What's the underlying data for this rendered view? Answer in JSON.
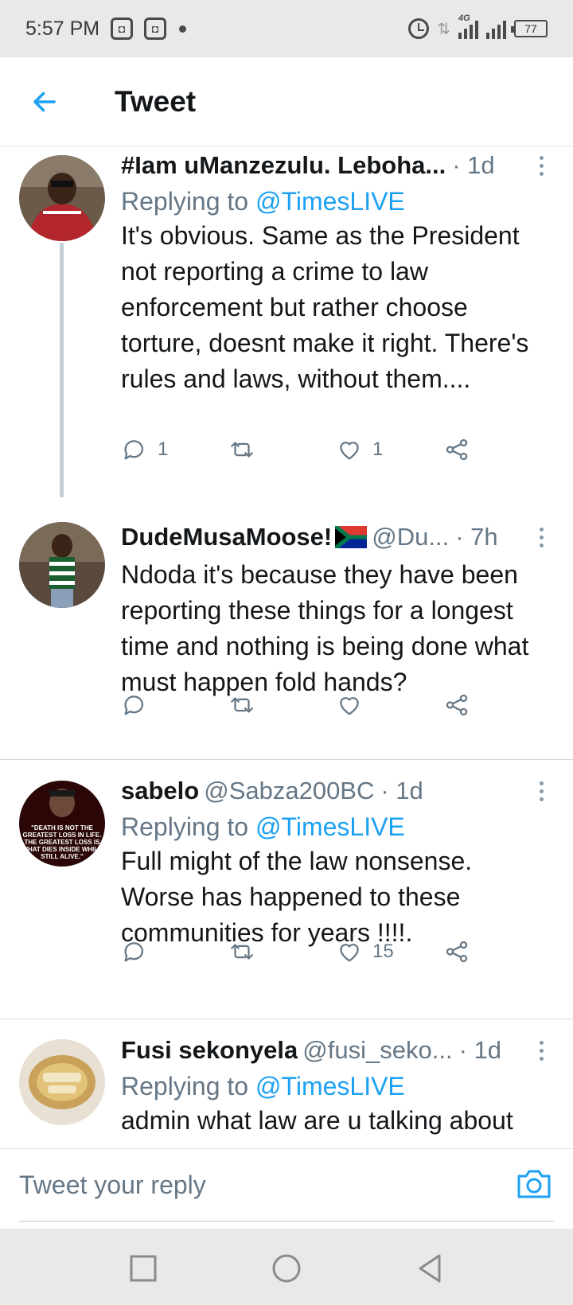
{
  "status_bar": {
    "time": "5:57 PM",
    "notification_icons": [
      "app-notification-icon",
      "app-notification-icon"
    ],
    "network": "4G",
    "battery": "77"
  },
  "header": {
    "title": "Tweet",
    "back_icon": "arrow-left-icon"
  },
  "tweets": [
    {
      "name": "#Iam uManzezulu. Leboha...",
      "handle": "",
      "time": "· 1d",
      "replying_prefix": "Replying to",
      "replying_to": "@TimesLIVE",
      "text": "It's obvious. Same as the President not reporting a crime to law enforcement but rather choose torture, doesnt make it right. There's rules and laws, without them....",
      "replies": "1",
      "retweets": "",
      "likes": "1"
    },
    {
      "name": "DudeMusaMoose!",
      "handle": "@Du...",
      "time": "· 7h",
      "replying_prefix": "",
      "replying_to": "",
      "text": "Ndoda it's because they have been reporting these things for a longest time and nothing is being done what must happen fold hands?",
      "replies": "",
      "retweets": "",
      "likes": ""
    },
    {
      "name": "sabelo",
      "handle": "@Sabza200BC",
      "time": "· 1d",
      "replying_prefix": "Replying to",
      "replying_to": "@TimesLIVE",
      "text": "Full might of the law nonsense. Worse has happened to these communities for years !!!!.",
      "replies": "",
      "retweets": "",
      "likes": "15"
    },
    {
      "name": "Fusi sekonyela",
      "handle": "@fusi_seko...",
      "time": "· 1d",
      "replying_prefix": "Replying to",
      "replying_to": "@TimesLIVE",
      "text": "admin what law are u talking about",
      "replies": "",
      "retweets": "",
      "likes": ""
    }
  ],
  "avatar3_text": "\"DEATH IS NOT THE GREATEST LOSS IN LIFE. THE GREATEST LOSS IS WHAT DIES INSIDE WHILE STILL ALIVE.\"",
  "compose": {
    "placeholder": "Tweet your reply",
    "camera_icon": "camera-icon"
  },
  "colors": {
    "accent": "#1da1f2",
    "muted": "#657786",
    "text": "#14171a",
    "divider": "#d3dbe1"
  }
}
